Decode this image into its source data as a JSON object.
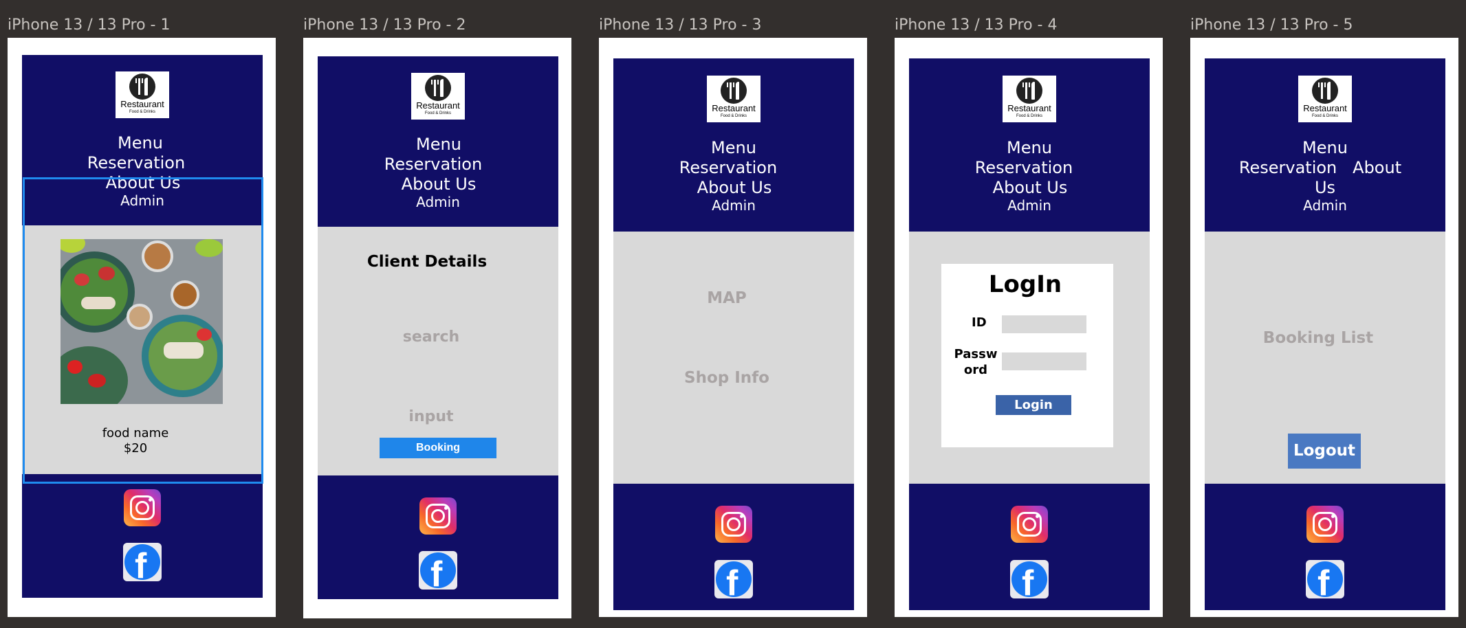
{
  "frames": [
    {
      "label": "iPhone 13 / 13 Pro - 1"
    },
    {
      "label": "iPhone 13 / 13 Pro - 2"
    },
    {
      "label": "iPhone 13 / 13 Pro - 3"
    },
    {
      "label": "iPhone 13 / 13 Pro - 4"
    },
    {
      "label": "iPhone 13 / 13 Pro - 5"
    }
  ],
  "logo": {
    "name": "Restaurant",
    "tagline": "Food & Drinks"
  },
  "nav": {
    "menu": "Menu",
    "reservation": "Reservation",
    "about": "About Us",
    "admin": "Admin",
    "about_word1": "About",
    "about_word2": "Us"
  },
  "page1": {
    "food_name": "food name",
    "price": "$20"
  },
  "page2": {
    "title": "Client Details",
    "search": "search",
    "input": "input",
    "booking_button": "Booking"
  },
  "page3": {
    "map": "MAP",
    "shop_info": "Shop Info"
  },
  "page4": {
    "title": "LogIn",
    "id_label": "ID",
    "password_label_1": "Passw",
    "password_label_2": "ord",
    "login_button": "Login"
  },
  "page5": {
    "booking_list": "Booking List",
    "logout_button": "Logout"
  },
  "colors": {
    "header": "#110e66",
    "content": "#d9d9d9",
    "canvas": "#332f2d",
    "selection": "#1f8bef"
  },
  "icons": [
    "restaurant-logo-icon",
    "instagram-icon",
    "facebook-icon"
  ]
}
